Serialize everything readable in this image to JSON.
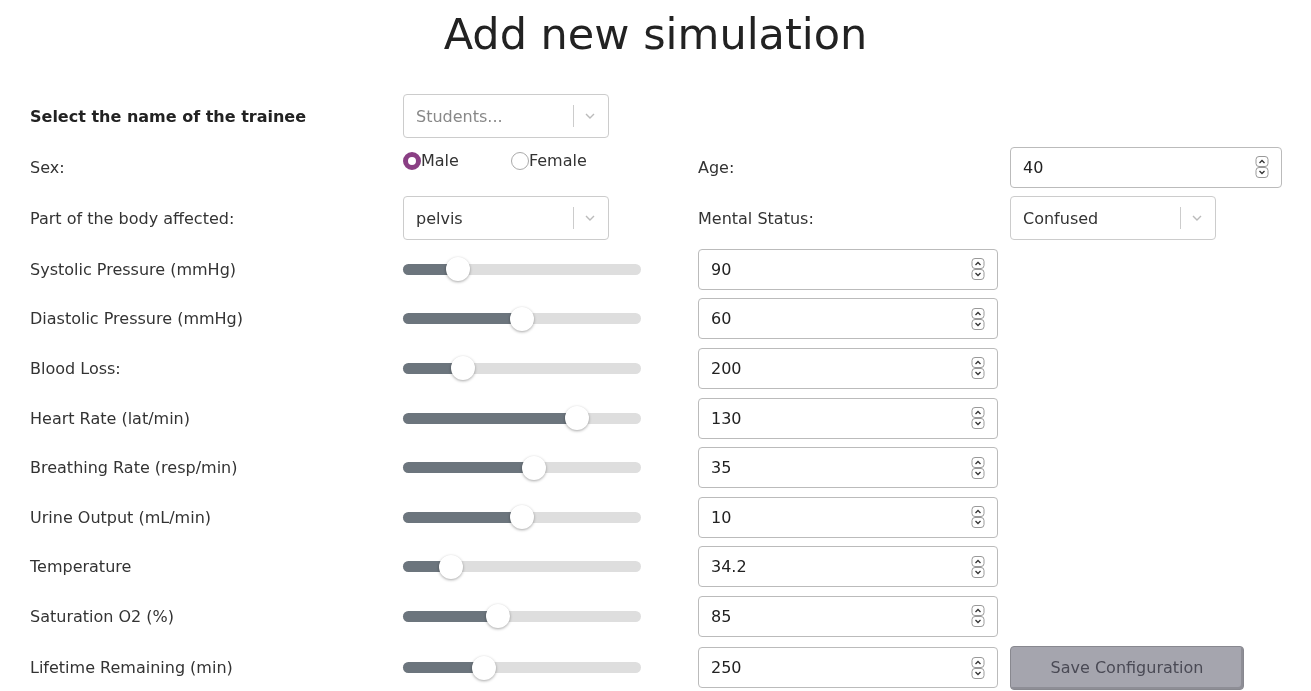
{
  "title": "Add new simulation",
  "trainee": {
    "label": "Select the name of the trainee",
    "placeholder": "Students..."
  },
  "sex": {
    "label": "Sex:",
    "options": [
      {
        "label": "Male",
        "selected": true
      },
      {
        "label": "Female",
        "selected": false
      }
    ]
  },
  "age": {
    "label": "Age:",
    "value": "40"
  },
  "body_part": {
    "label": "Part of the body affected:",
    "value": "pelvis"
  },
  "mental_status": {
    "label": "Mental Status:",
    "value": "Confused"
  },
  "parameters": [
    {
      "label": "Systolic Pressure (mmHg)",
      "level": 0.23,
      "value": "90"
    },
    {
      "label": "Diastolic Pressure (mmHg)",
      "level": 0.5,
      "value": "60"
    },
    {
      "label": "Blood Loss:",
      "level": 0.25,
      "value": "200"
    },
    {
      "label": "Heart Rate (lat/min)",
      "level": 0.73,
      "value": "130"
    },
    {
      "label": "Breathing Rate (resp/min)",
      "level": 0.55,
      "value": "35"
    },
    {
      "label": "Urine Output (mL/min)",
      "level": 0.5,
      "value": "10"
    },
    {
      "label": "Temperature",
      "level": 0.2,
      "value": "34.2"
    },
    {
      "label": "Saturation O2 (%)",
      "level": 0.4,
      "value": "85"
    },
    {
      "label": "Lifetime Remaining (min)",
      "level": 0.34,
      "value": "250"
    }
  ],
  "save_button": {
    "label": "Save Configuration",
    "disabled": true
  }
}
